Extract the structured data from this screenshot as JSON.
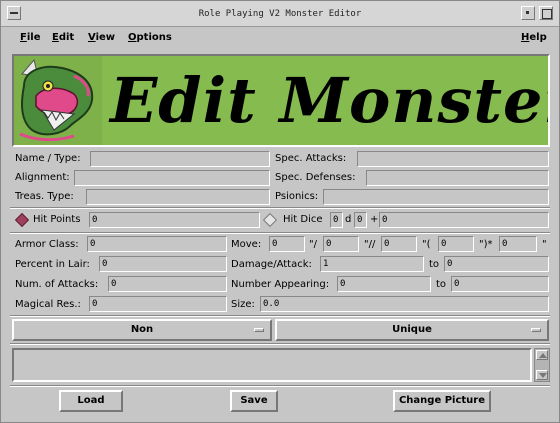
{
  "window": {
    "title": "Role Playing V2 Monster Editor"
  },
  "menu": {
    "file": {
      "underline": "F",
      "rest": "ile"
    },
    "edit": {
      "underline": "E",
      "rest": "dit"
    },
    "view": {
      "underline": "V",
      "rest": "iew"
    },
    "options": {
      "underline": "O",
      "rest": "ptions"
    },
    "help": {
      "underline": "H",
      "rest": "elp"
    }
  },
  "banner": {
    "text": "Edit Monster",
    "background": "#86bb50"
  },
  "form": {
    "name_type": {
      "label": "Name / Type:",
      "value": ""
    },
    "spec_attacks": {
      "label": "Spec. Attacks:",
      "value": ""
    },
    "alignment": {
      "label": "Alignment:",
      "value": ""
    },
    "spec_defenses": {
      "label": "Spec. Defenses:",
      "value": ""
    },
    "treas_type": {
      "label": "Treas. Type:",
      "value": ""
    },
    "psionics": {
      "label": "Psionics:",
      "value": ""
    },
    "hit_points": {
      "label": "Hit Points",
      "value": "0",
      "selected": true
    },
    "hit_dice": {
      "label": "Hit Dice",
      "count": "0",
      "d": "d",
      "sides": "0",
      "plus": "+",
      "bonus": "0",
      "selected": false
    },
    "armor_class": {
      "label": "Armor Class:",
      "value": "0"
    },
    "move": {
      "label": "Move:",
      "v1": "0",
      "sep1": "\"/",
      "v2": "0",
      "sep2": "\"//",
      "v3": "0",
      "sep3": "\"(",
      "v4": "0",
      "sep4": "\")*",
      "v5": "0",
      "sep5": "\""
    },
    "percent_in_lair": {
      "label": "Percent in Lair:",
      "value": "0"
    },
    "damage_attack": {
      "label": "Damage/Attack:",
      "from": "1",
      "to_label": "to",
      "to": "0"
    },
    "num_attacks": {
      "label": "Num. of Attacks:",
      "value": "0"
    },
    "number_appearing": {
      "label": "Number Appearing:",
      "from": "0",
      "to_label": "to",
      "to": "0"
    },
    "magical_res": {
      "label": "Magical Res.:",
      "value": "0"
    },
    "size": {
      "label": "Size:",
      "value": "0.0"
    }
  },
  "options": {
    "left": "Non",
    "right": "Unique"
  },
  "buttons": {
    "load": "Load",
    "save": "Save",
    "change_picture": "Change Picture"
  }
}
